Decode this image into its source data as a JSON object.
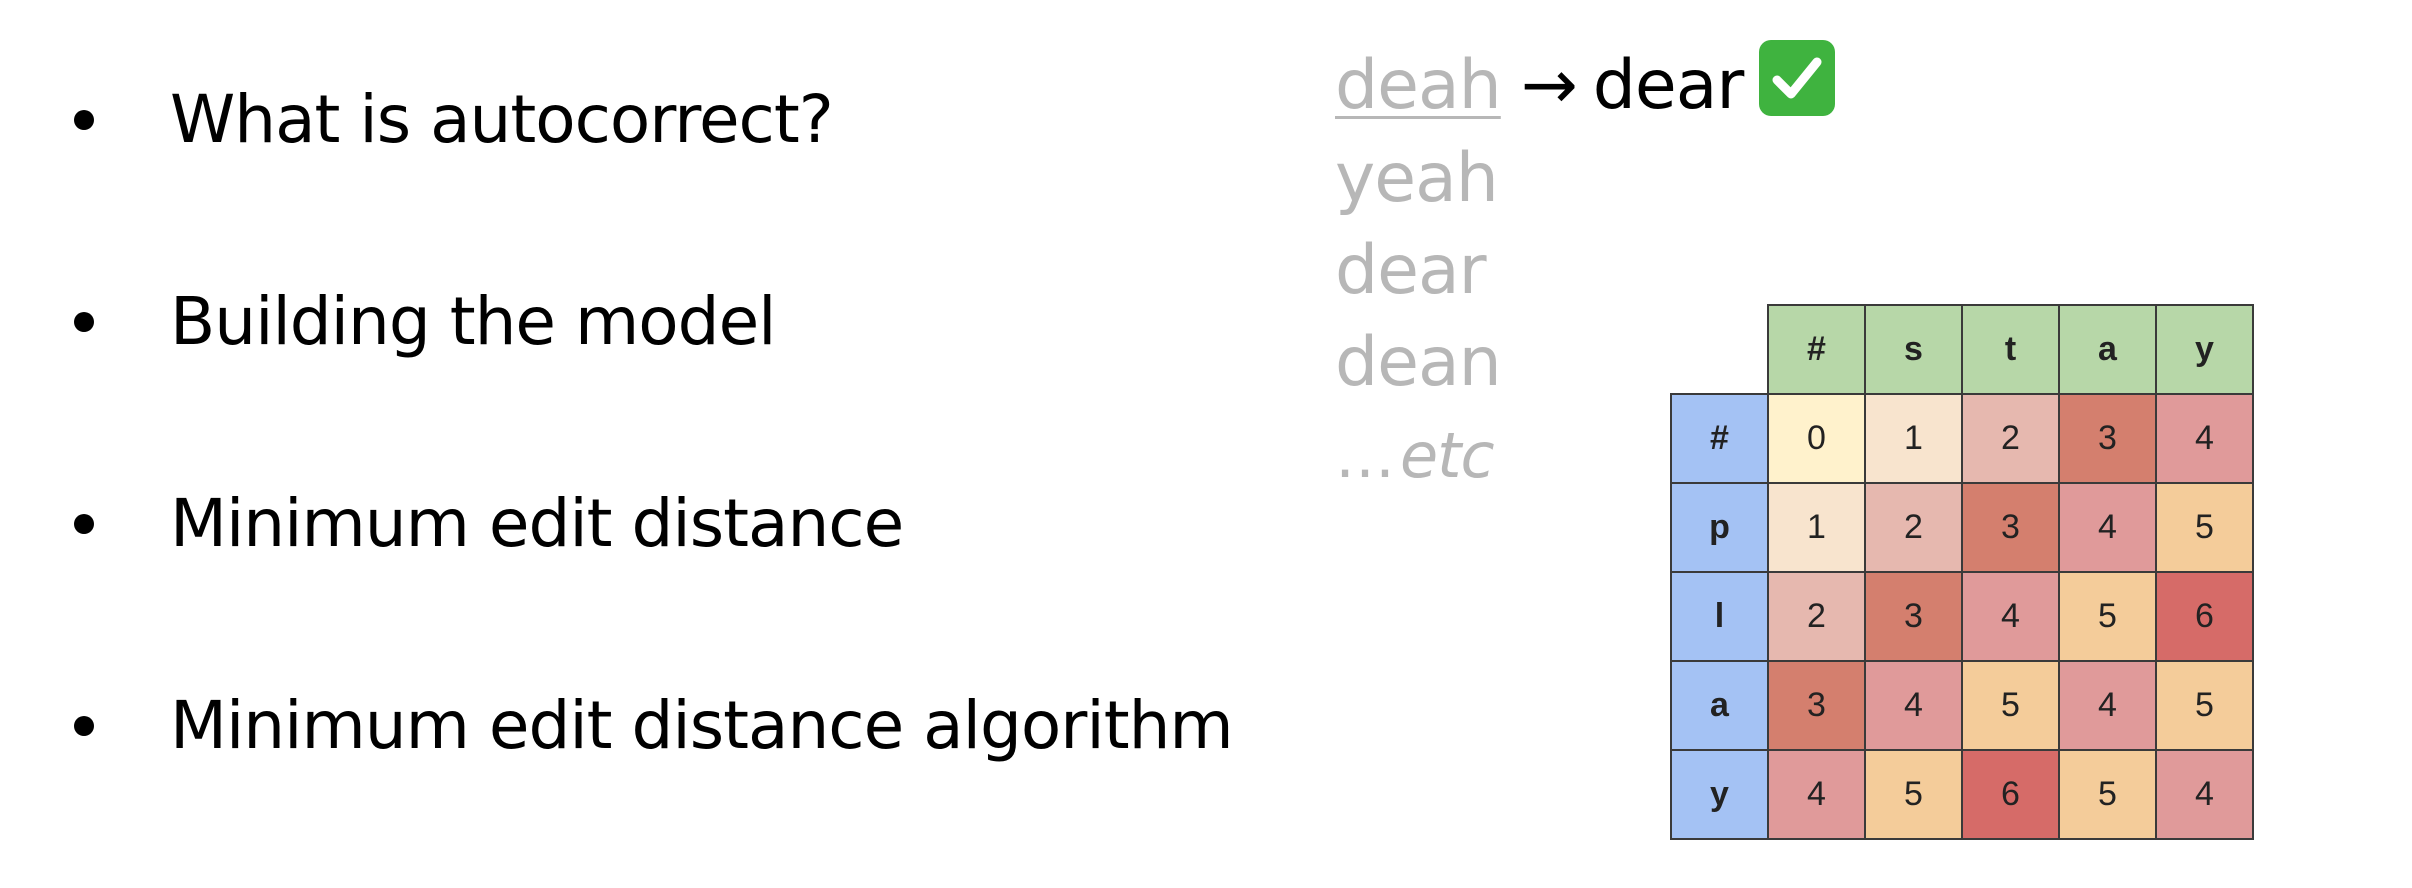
{
  "bullets": [
    {
      "text": "What is autocorrect?"
    },
    {
      "text": "Building the model"
    },
    {
      "text": "Minimum edit distance"
    },
    {
      "text": "Minimum edit distance algorithm"
    }
  ],
  "example": {
    "typo": "deah",
    "arrow": "→",
    "correct": "dear",
    "check_icon": "check-mark-button",
    "candidates": [
      "yeah",
      "dear",
      "dean"
    ],
    "etc_dots": "…",
    "etc_word": "etc"
  },
  "table": {
    "columns": [
      "#",
      "s",
      "t",
      "a",
      "y"
    ],
    "rows": [
      {
        "label": "#",
        "cells": [
          "0",
          "1",
          "2",
          "3",
          "4"
        ]
      },
      {
        "label": "p",
        "cells": [
          "1",
          "2",
          "3",
          "4",
          "5"
        ]
      },
      {
        "label": "l",
        "cells": [
          "2",
          "3",
          "4",
          "5",
          "6"
        ]
      },
      {
        "label": "a",
        "cells": [
          "3",
          "4",
          "5",
          "4",
          "5"
        ]
      },
      {
        "label": "y",
        "cells": [
          "4",
          "5",
          "6",
          "5",
          "4"
        ]
      }
    ],
    "cell_colors": [
      [
        "#fff2cc",
        "#f8e4ce",
        "#e6b8af",
        "#d47f6e",
        "#e09a9a"
      ],
      [
        "#f8e4ce",
        "#e6b8af",
        "#d47f6e",
        "#e09a9a",
        "#f4cc9a"
      ],
      [
        "#e6b8af",
        "#d47f6e",
        "#e09a9a",
        "#f4cc9a",
        "#d66b68"
      ],
      [
        "#d47f6e",
        "#e09a9a",
        "#f4cc9a",
        "#e09a9a",
        "#f4cc9a"
      ],
      [
        "#e09a9a",
        "#f4cc9a",
        "#d66b68",
        "#f4cc9a",
        "#e09a9a"
      ]
    ],
    "header_color_columns": "#b7d7a8",
    "header_color_rows": "#a4c2f4"
  }
}
